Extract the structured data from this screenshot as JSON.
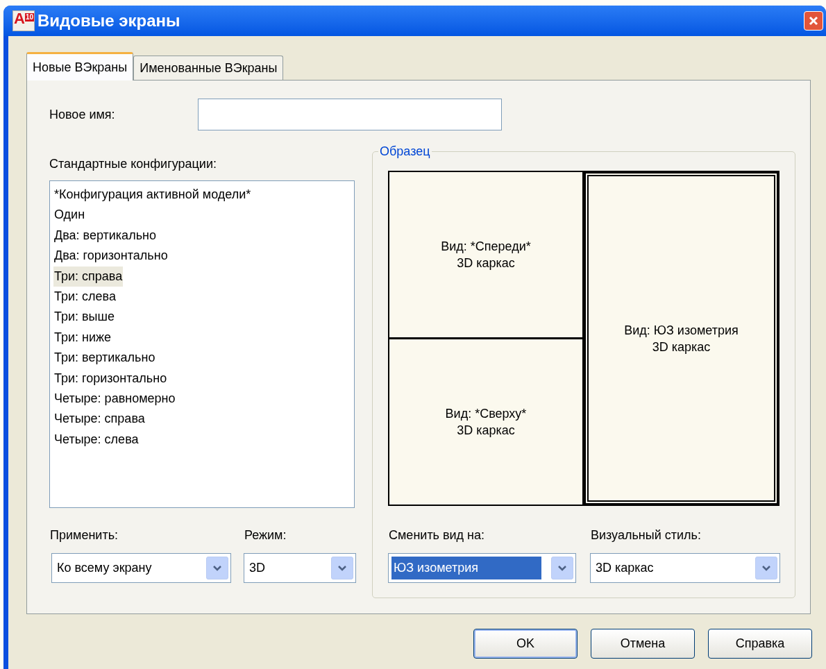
{
  "window": {
    "title": "Видовые экраны",
    "app_letter": "A",
    "app_badge": "10"
  },
  "tabs": [
    {
      "label": "Новые ВЭкраны",
      "selected": true
    },
    {
      "label": "Именованные ВЭкраны",
      "selected": false
    }
  ],
  "new_name": {
    "label": "Новое имя:"
  },
  "configurations": {
    "label": "Стандартные конфигурации:",
    "items": [
      {
        "label": "*Конфигурация активной модели*",
        "selected": false
      },
      {
        "label": "Один",
        "selected": false
      },
      {
        "label": "Два: вертикально",
        "selected": false
      },
      {
        "label": "Два: горизонтально",
        "selected": false
      },
      {
        "label": "Три: справа",
        "selected": true
      },
      {
        "label": "Три: слева",
        "selected": false
      },
      {
        "label": "Три: выше",
        "selected": false
      },
      {
        "label": "Три: ниже",
        "selected": false
      },
      {
        "label": "Три: вертикально",
        "selected": false
      },
      {
        "label": "Три: горизонтально",
        "selected": false
      },
      {
        "label": "Четыре: равномерно",
        "selected": false
      },
      {
        "label": "Четыре: справа",
        "selected": false
      },
      {
        "label": "Четыре: слева",
        "selected": false
      }
    ]
  },
  "preview": {
    "title": "Образец",
    "viewports": [
      {
        "view": "Вид: *Спереди*",
        "style": "3D каркас",
        "selected": false
      },
      {
        "view": "Вид: *Сверху*",
        "style": "3D каркас",
        "selected": false
      },
      {
        "view": "Вид: ЮЗ изометрия",
        "style": "3D каркас",
        "selected": true
      }
    ]
  },
  "left_combos": [
    {
      "label": "Применить:",
      "value": "Ко всему экрану",
      "focused": false
    },
    {
      "label": "Режим:",
      "value": "3D",
      "focused": false
    }
  ],
  "right_combos": [
    {
      "label": "Сменить вид на:",
      "value": "ЮЗ изометрия",
      "focused": true
    },
    {
      "label": "Визуальный стиль:",
      "value": "3D каркас",
      "focused": false
    }
  ],
  "buttons": [
    {
      "label": "OK",
      "default": true
    },
    {
      "label": "Отмена",
      "default": false
    },
    {
      "label": "Справка",
      "default": false
    }
  ]
}
